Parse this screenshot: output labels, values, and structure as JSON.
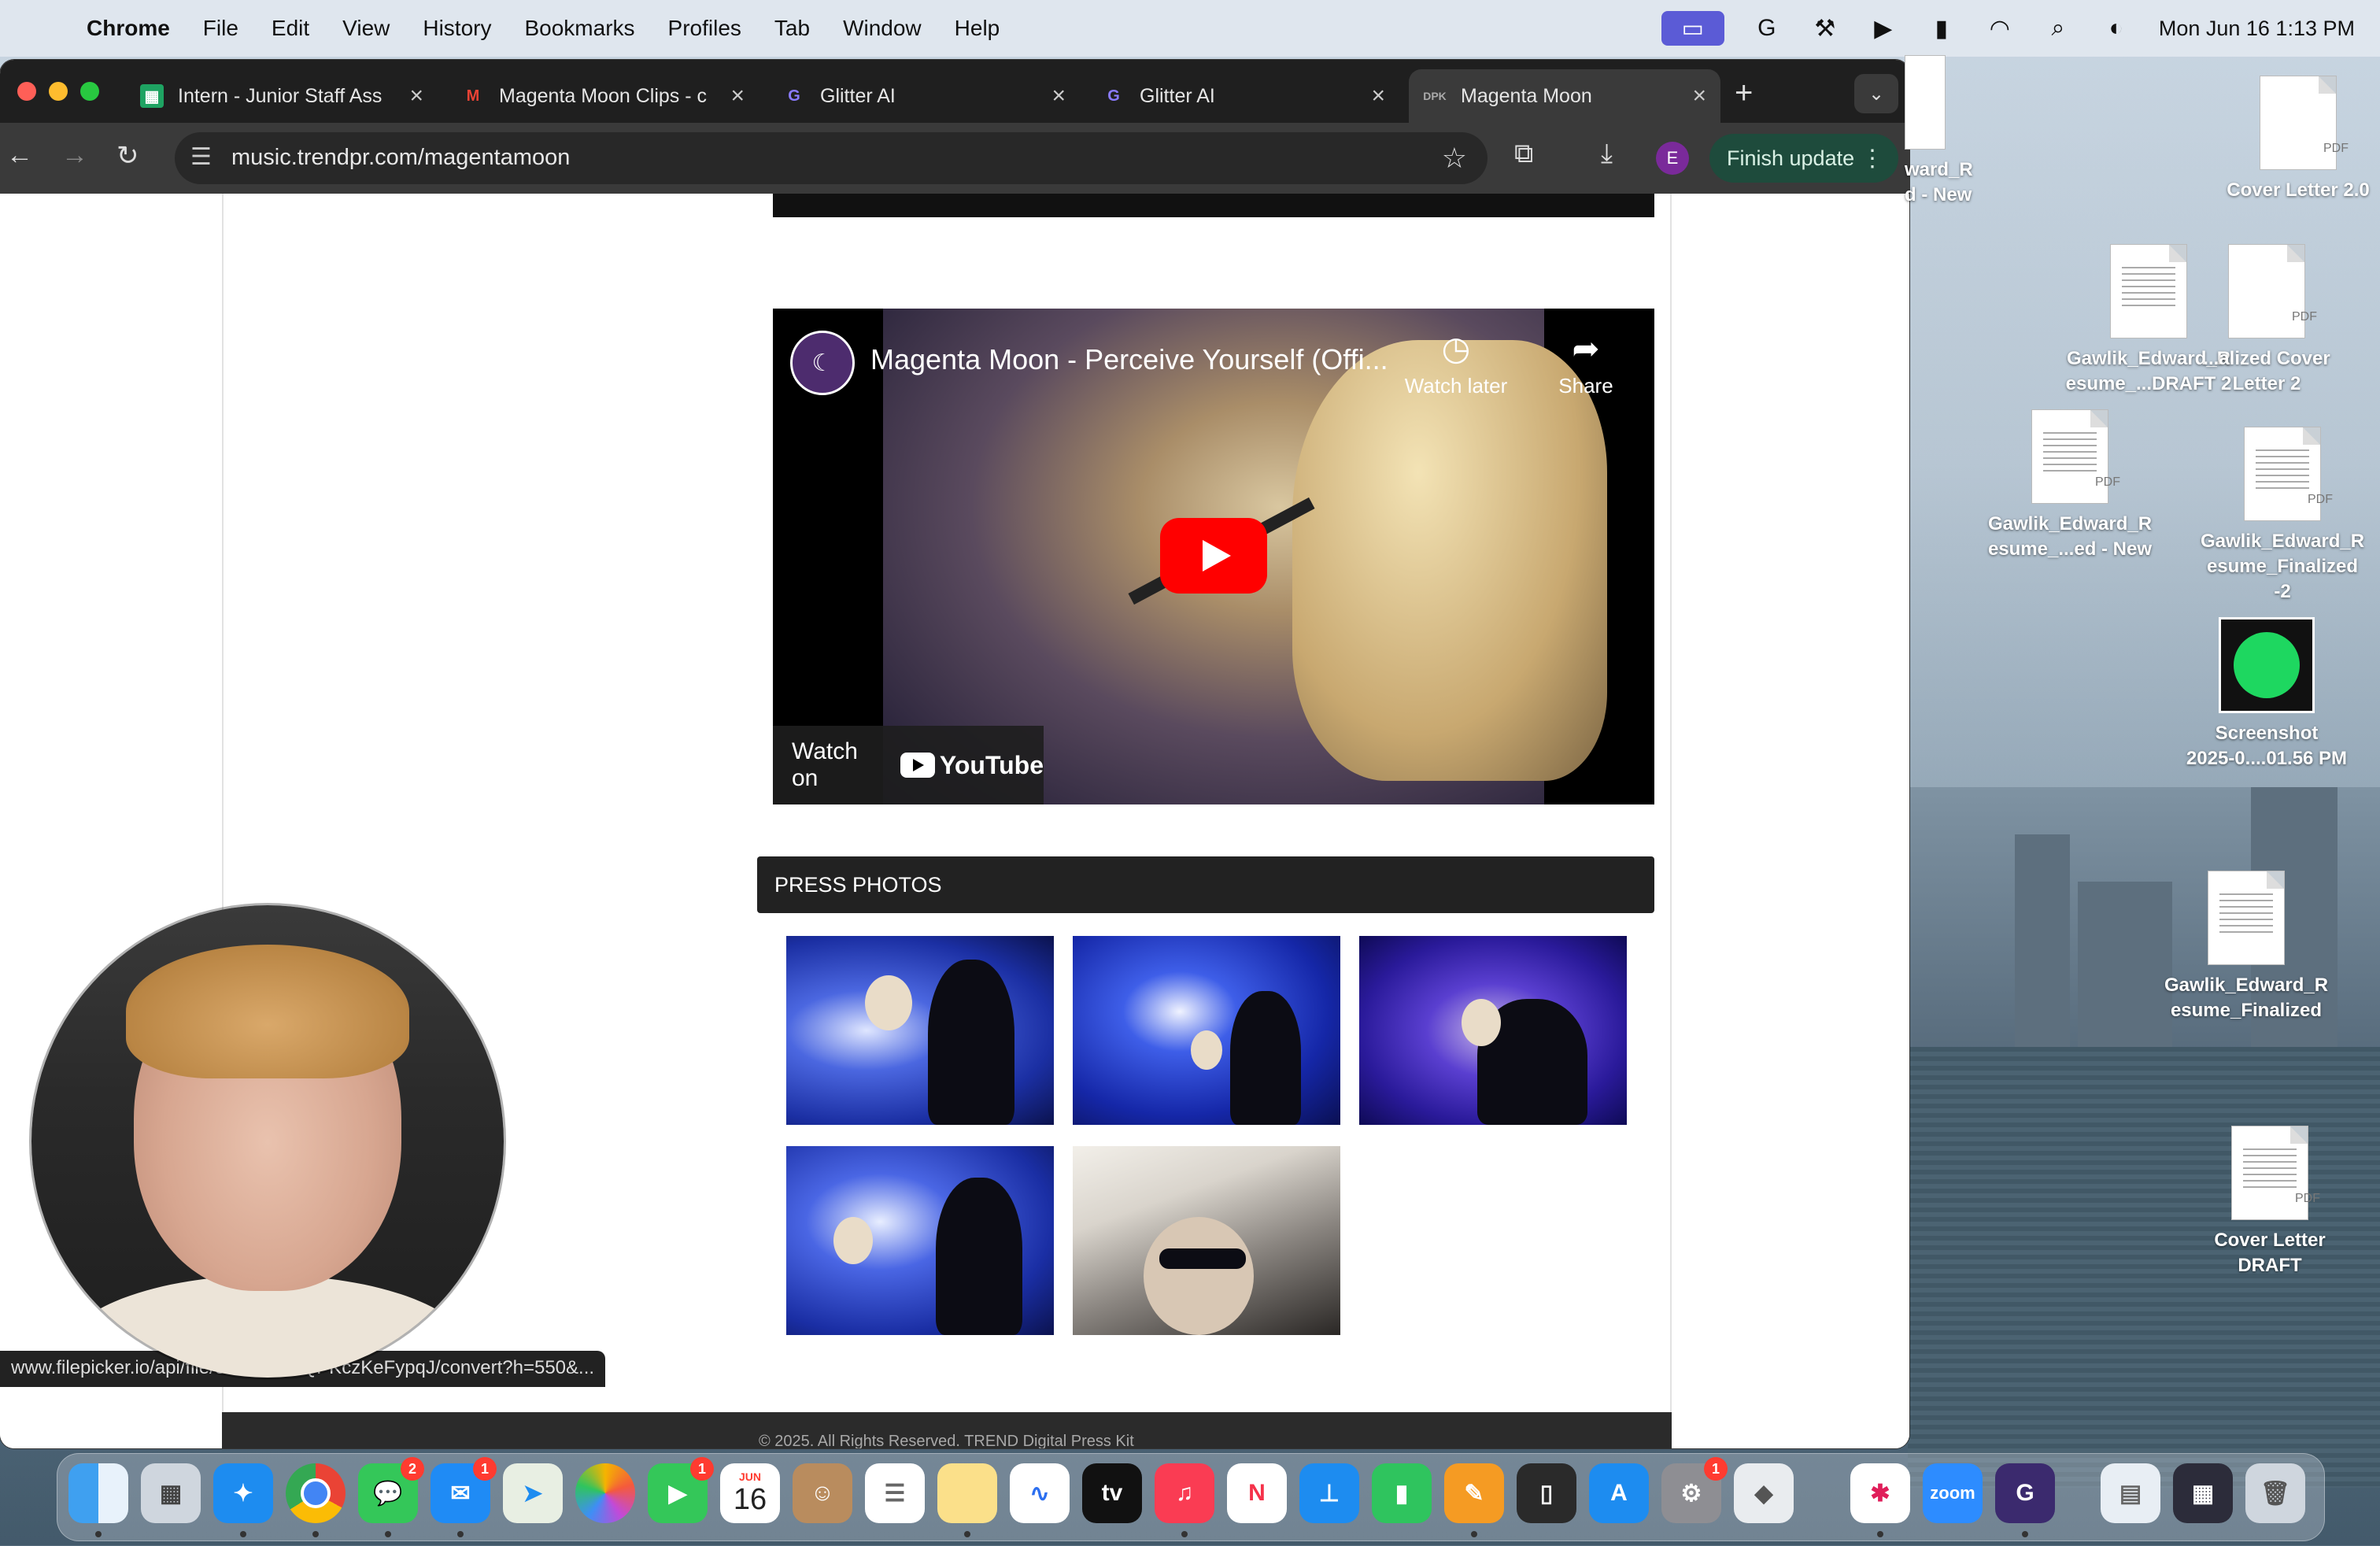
{
  "menubar": {
    "app": "Chrome",
    "items": [
      "File",
      "Edit",
      "View",
      "History",
      "Bookmarks",
      "Profiles",
      "Tab",
      "Window",
      "Help"
    ],
    "clock": "Mon Jun 16  1:13 PM"
  },
  "tabs": [
    {
      "title": "Intern - Junior Staff Ass",
      "favicon": "sheets-icon"
    },
    {
      "title": "Magenta Moon Clips - c",
      "favicon": "gmail-icon"
    },
    {
      "title": "Glitter AI",
      "favicon": "glitter-icon"
    },
    {
      "title": "Glitter AI",
      "favicon": "glitter-icon"
    },
    {
      "title": "Magenta Moon",
      "favicon": "dpk-icon"
    }
  ],
  "toolbar": {
    "url": "music.trendpr.com/magentamoon",
    "profile_initial": "E",
    "finish_update": "Finish update"
  },
  "video": {
    "title": "Magenta Moon - Perceive Yourself (Offi...",
    "watch_later": "Watch later",
    "share": "Share",
    "watch_on": "Watch on",
    "youtube": "YouTube"
  },
  "press": {
    "heading": "PRESS PHOTOS"
  },
  "footer": {
    "text": "© 2025. All Rights Reserved. TREND Digital Press Kit"
  },
  "status_url": "www.filepicker.io/api/file/e5fC0XN1QPKczKeFypqJ/convert?h=550&...",
  "desktop": {
    "icons": [
      {
        "label": "ward_R\nd - New"
      },
      {
        "label": "Cover Letter 2.0"
      },
      {
        "label": "Gawlik_Edward_R\nesume_...DRAFT 2"
      },
      {
        "label": "...alized Cover\nLetter 2"
      },
      {
        "label": "Gawlik_Edward_R\nesume_...ed - New"
      },
      {
        "label": "Gawlik_Edward_R\nesume_Finalized -2"
      },
      {
        "label": "Screenshot\n2025-0....01.56 PM"
      },
      {
        "label": "Gawlik_Edward_R\nesume_Finalized"
      },
      {
        "label": "Cover Letter\nDRAFT"
      }
    ]
  },
  "dock": {
    "calendar_month": "JUN",
    "calendar_day": "16",
    "badges": {
      "messages": "2",
      "mail": "1",
      "facetime": "1",
      "settings": "1"
    },
    "zoom": "zoom"
  }
}
